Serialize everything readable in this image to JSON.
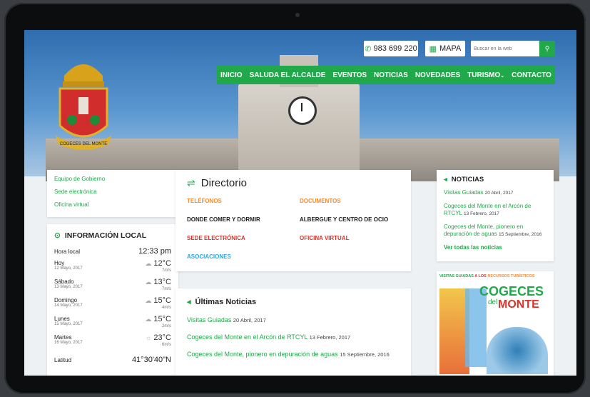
{
  "phone": "983 699 220",
  "map_label": "MAPA",
  "search_placeholder": "Buscar en la web",
  "nav": [
    "INICIO",
    "SALUDA EL ALCALDE",
    "EVENTOS",
    "NOTICIAS",
    "NOVEDADES",
    "TURISMO",
    "CONTACTO"
  ],
  "crest_text": "COGECES DEL MONTE",
  "quick_links": [
    "Equipo de Gobierno",
    "Sede electrónica",
    "Oficina virtual"
  ],
  "info": {
    "title": "INFORMACIÓN LOCAL",
    "hora_label": "Hora local",
    "hora": "12:33 pm",
    "days": [
      {
        "day": "Hoy",
        "date": "12 Mayo, 2017",
        "temp": "12°C",
        "wind": "7m/s"
      },
      {
        "day": "Sábado",
        "date": "13 Mayo, 2017",
        "temp": "13°C",
        "wind": "7m/s"
      },
      {
        "day": "Domingo",
        "date": "14 Mayo, 2017",
        "temp": "15°C",
        "wind": "4m/s"
      },
      {
        "day": "Lunes",
        "date": "15 Mayo, 2017",
        "temp": "15°C",
        "wind": "2m/s"
      },
      {
        "day": "Martes",
        "date": "16 Mayo, 2017",
        "temp": "23°C",
        "wind": "6m/s"
      }
    ],
    "lat_label": "Latitud",
    "lat": "41°30'40\"N"
  },
  "directorio": {
    "title": "Directorio",
    "items": [
      "TELÉFONOS",
      "DOCUMENTOS",
      "DONDE COMER Y DORMIR",
      "ALBERGUE Y CENTRO DE OCIO",
      "SEDE ELECTRÓNICA",
      "OFICINA VIRTUAL",
      "ASOCIACIONES"
    ]
  },
  "ultimas": {
    "title": "Últimas Noticias",
    "items": [
      {
        "t": "Visitas Guiadas",
        "d": "20 Abril, 2017"
      },
      {
        "t": "Cogeces del Monte en el Arcón de RTCYL",
        "d": "13 Febrero, 2017"
      },
      {
        "t": "Cogeces del Monte, pionero en depuración de aguas",
        "d": "15 Septiembre, 2016"
      }
    ]
  },
  "noticias": {
    "title": "NOTICIAS",
    "items": [
      {
        "t": "Visitas Guiadas",
        "d": "20 Abril, 2017"
      },
      {
        "t": "Cogeces del Monte en el Arcón de RTCYL",
        "d": "13 Febrero, 2017"
      },
      {
        "t": "Cogeces del Monte, pionero en depuración de aguas",
        "d": "15 Septiembre, 2016"
      }
    ],
    "all": "Ver todas las noticias"
  },
  "banner": {
    "top1": "VISITAS GUIADAS",
    "top2": "A LOS",
    "top3": "RECURSOS TURÍSTICOS",
    "big1": "COGECES",
    "small": "del",
    "big2": "MONTE"
  }
}
